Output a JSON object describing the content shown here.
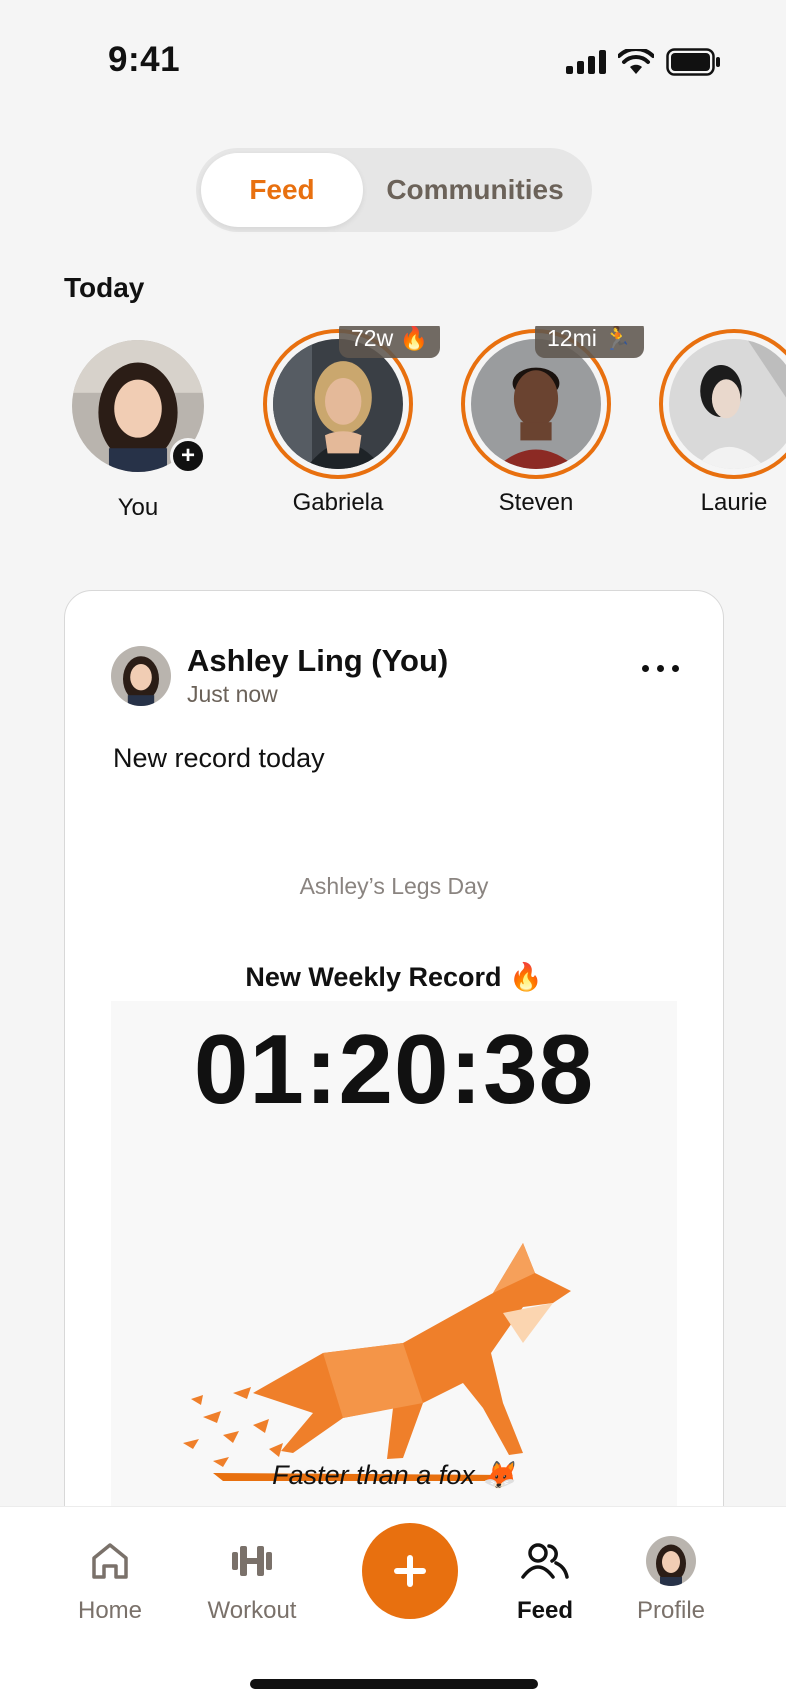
{
  "status_bar": {
    "time": "9:41"
  },
  "segments": {
    "active": "Feed",
    "inactive": "Communities"
  },
  "today_heading": "Today",
  "stories": [
    {
      "name": "You",
      "badge": "",
      "has_ring": false,
      "add": "+"
    },
    {
      "name": "Gabriela",
      "badge": "72w 🔥",
      "has_ring": true
    },
    {
      "name": "Steven",
      "badge": "12mi 🏃",
      "has_ring": true
    },
    {
      "name": "Laurie",
      "badge": "",
      "has_ring": true
    }
  ],
  "post": {
    "author": "Ashley Ling (You)",
    "time": "Just now",
    "text": "New record today",
    "workout_title": "Ashley’s Legs Day",
    "record_label": "New Weekly Record 🔥",
    "record_time": "01:20:38",
    "caption": "Faster than a fox 🦊"
  },
  "nav": {
    "home": "Home",
    "workout": "Workout",
    "feed": "Feed",
    "profile": "Profile",
    "active": "feed"
  },
  "colors": {
    "accent": "#e8700f",
    "background": "#f5f5f5"
  }
}
